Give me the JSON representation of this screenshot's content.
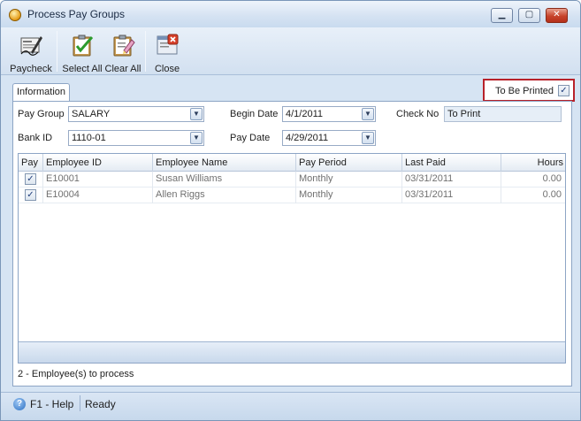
{
  "window": {
    "title": "Process Pay Groups",
    "minimize": "▁",
    "maximize": "▢",
    "close": "✕"
  },
  "toolbar": {
    "paycheck": "Paycheck",
    "select_all": "Select All",
    "clear_all": "Clear All",
    "close": "Close"
  },
  "tabs": {
    "information": "Information"
  },
  "to_be_printed": {
    "label": "To Be Printed",
    "checked": "✓"
  },
  "form": {
    "pay_group_label": "Pay Group",
    "pay_group_value": "SALARY",
    "bank_id_label": "Bank ID",
    "bank_id_value": "1110-01",
    "begin_date_label": "Begin Date",
    "begin_date_value": "4/1/2011",
    "pay_date_label": "Pay Date",
    "pay_date_value": "4/29/2011",
    "check_no_label": "Check No",
    "check_no_value": "To Print",
    "dropdown_glyph": "▼"
  },
  "grid": {
    "columns": [
      "Pay",
      "Employee ID",
      "Employee Name",
      "Pay Period",
      "Last Paid",
      "Hours"
    ],
    "rows": [
      {
        "pay": "✓",
        "employee_id": "E10001",
        "employee_name": "Susan Williams",
        "pay_period": "Monthly",
        "last_paid": "03/31/2011",
        "hours": "0.00"
      },
      {
        "pay": "✓",
        "employee_id": "E10004",
        "employee_name": "Allen Riggs",
        "pay_period": "Monthly",
        "last_paid": "03/31/2011",
        "hours": "0.00"
      }
    ]
  },
  "process_text": "2 -  Employee(s) to process",
  "status": {
    "help": "F1 - Help",
    "state": "Ready",
    "help_glyph": "?"
  },
  "colors": {
    "highlight_border": "#b8222a",
    "accent": "#2a6fc2"
  }
}
